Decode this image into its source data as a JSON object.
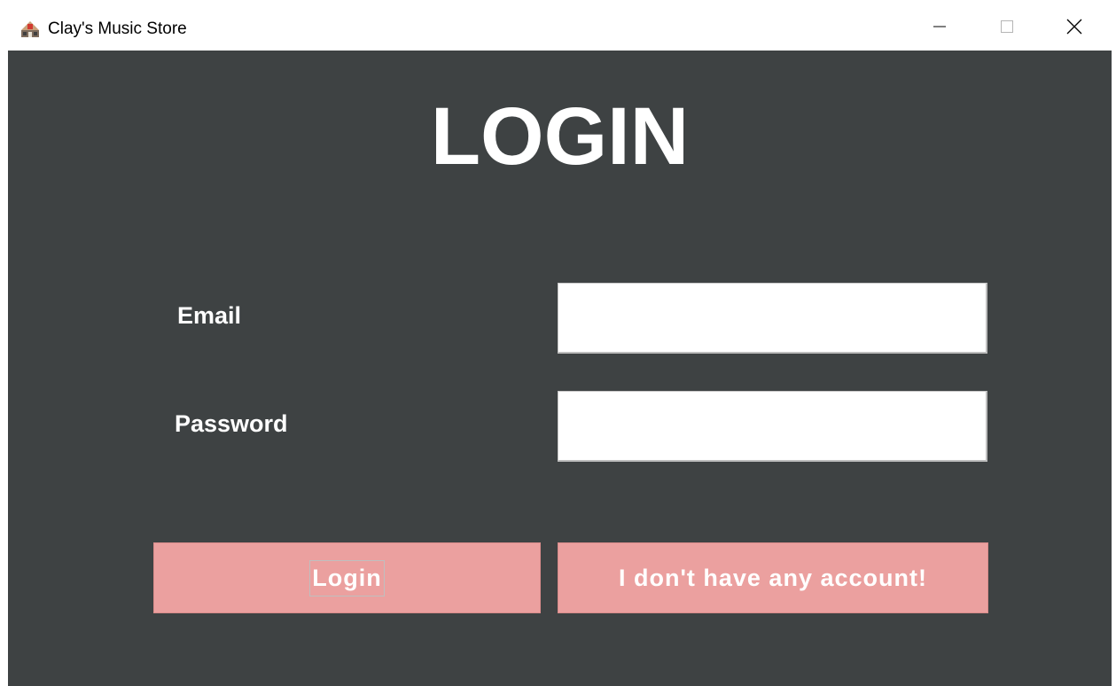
{
  "window": {
    "title": "Clay's Music Store",
    "app_icon": "music-store-icon",
    "controls": {
      "minimize_icon": "minimize-icon",
      "maximize_icon": "maximize-icon",
      "close_icon": "close-icon"
    }
  },
  "login_form": {
    "heading": "LOGIN",
    "email_label": "Email",
    "email_value": "",
    "password_label": "Password",
    "password_value": "",
    "login_button": "Login",
    "no_account_button": "I don't have any account!"
  },
  "colors": {
    "background": "#3e4243",
    "button": "#eba09f",
    "text": "#ffffff"
  }
}
